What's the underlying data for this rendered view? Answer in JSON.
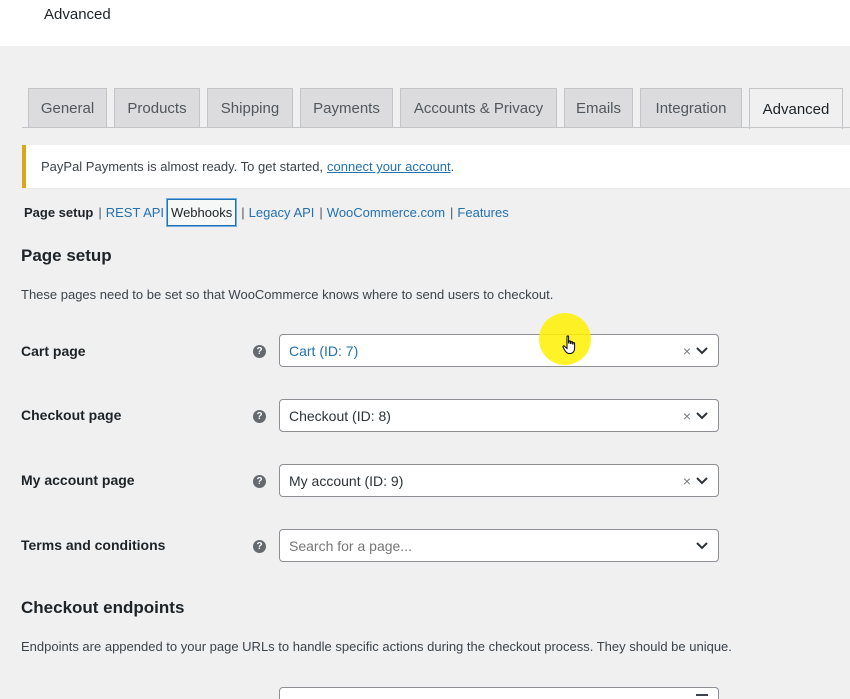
{
  "header": {
    "title": "Advanced"
  },
  "tabs": [
    {
      "label": "General"
    },
    {
      "label": "Products"
    },
    {
      "label": "Shipping"
    },
    {
      "label": "Payments"
    },
    {
      "label": "Accounts & Privacy"
    },
    {
      "label": "Emails"
    },
    {
      "label": "Integration"
    },
    {
      "label": "Advanced",
      "active": true
    }
  ],
  "notice": {
    "text": "PayPal Payments is almost ready. To get started,",
    "link": "connect your account",
    "suffix": "."
  },
  "subnav": {
    "current": "Page setup",
    "links": [
      "REST API",
      "Webhooks",
      "Legacy API",
      "WooCommerce.com",
      "Features"
    ]
  },
  "page_setup": {
    "heading": "Page setup",
    "description": "These pages need to be set so that WooCommerce knows where to send users to checkout.",
    "rows": [
      {
        "label": "Cart page",
        "value": "Cart (ID: 7)",
        "clear": "×"
      },
      {
        "label": "Checkout page",
        "value": "Checkout (ID: 8)",
        "clear": "×"
      },
      {
        "label": "My account page",
        "value": "My account (ID: 9)",
        "clear": "×"
      },
      {
        "label": "Terms and conditions",
        "placeholder": "Search for a page..."
      }
    ],
    "help_glyph": "?"
  },
  "checkout_endpoints": {
    "heading": "Checkout endpoints",
    "description": "Endpoints are appended to your page URLs to handle specific actions during the checkout process. They should be unique."
  },
  "colors": {
    "accent": "#2271b1",
    "notice_border": "#dba617",
    "cursor_highlight": "#fff000"
  }
}
